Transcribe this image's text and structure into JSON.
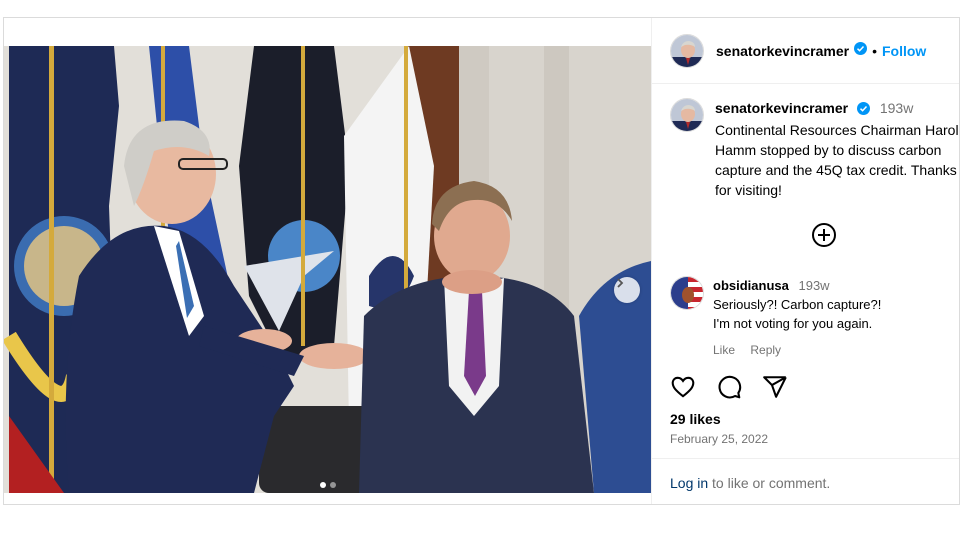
{
  "post": {
    "author": {
      "username": "senatorkevincramer",
      "verified": true
    },
    "follow_label": "Follow",
    "bullet": "•",
    "caption": {
      "time": "193w",
      "text": "Continental Resources Chairman Harold Hamm stopped by to discuss carbon capture and the 45Q tax credit. Thanks for visiting!"
    },
    "carousel": {
      "slide_count": 2,
      "current_slide": 1
    },
    "comments": [
      {
        "username": "obsidianusa",
        "time": "193w",
        "line1": "Seriously?! Carbon capture?!",
        "line2": "I'm not voting for you again.",
        "like_label": "Like",
        "reply_label": "Reply"
      }
    ],
    "likes": "29 likes",
    "date": "February 25, 2022",
    "login_link": "Log in",
    "login_rest": " to like or comment."
  },
  "icons": {
    "heart": "heart-icon",
    "comment": "comment-icon",
    "share": "share-icon",
    "plus": "plus-circle-icon",
    "verified": "verified-badge-icon",
    "next": "chevron-right-icon"
  },
  "colors": {
    "link_blue": "#0095f6",
    "secondary_text": "#737373",
    "border": "#dbdbdb",
    "verified_blue": "#0095f6"
  }
}
